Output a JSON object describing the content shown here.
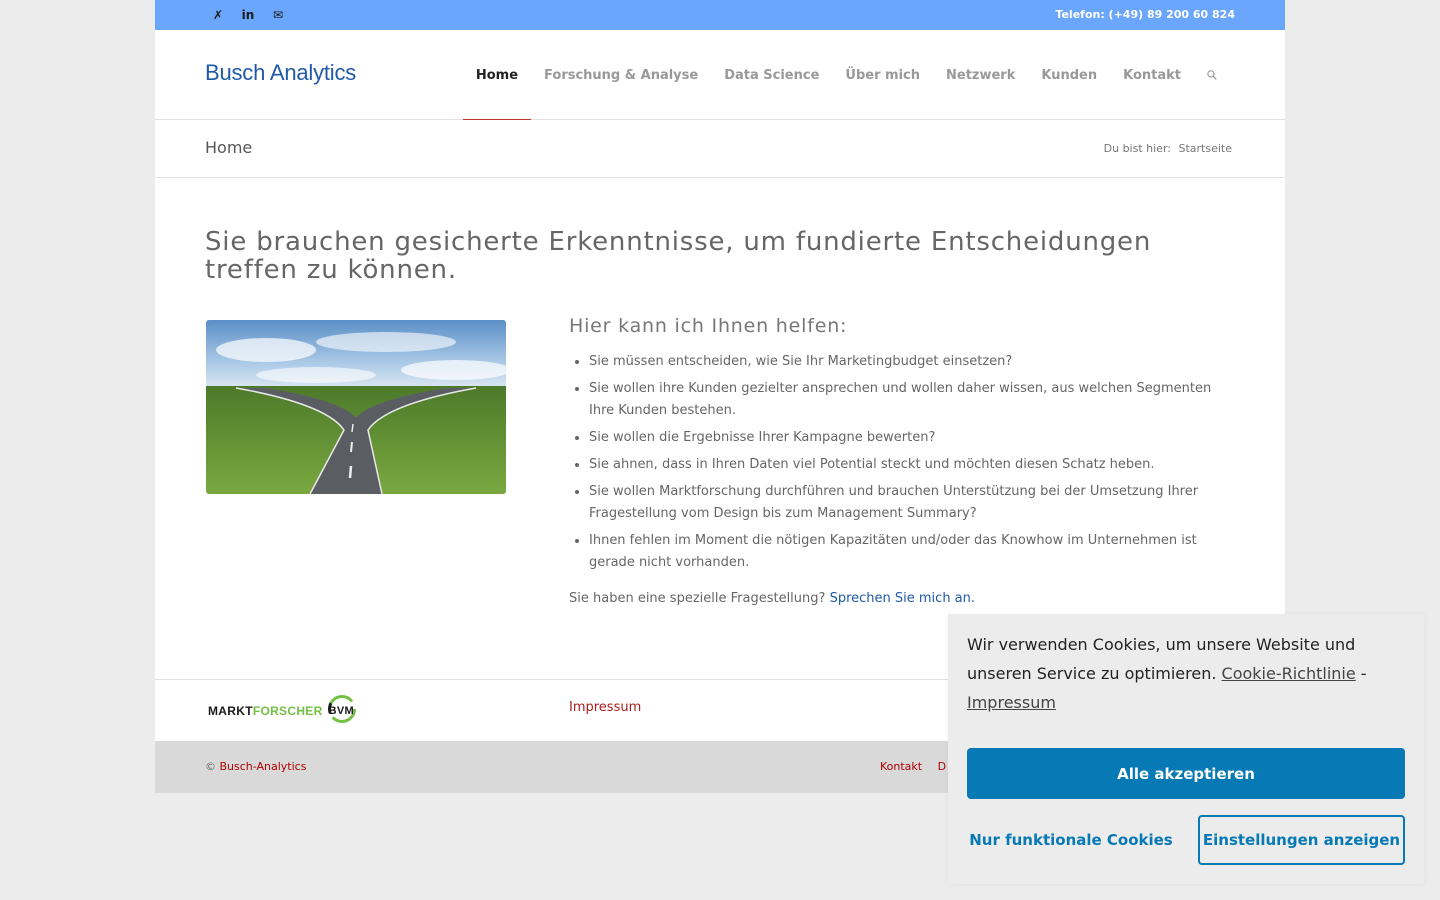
{
  "topbar": {
    "social": [
      "xing-icon",
      "linkedin-icon",
      "mail-icon"
    ],
    "xing_glyph": "✗",
    "linkedin_glyph": "in",
    "mail_glyph": "✉",
    "phone": "Telefon: (+49) 89 200 60 824"
  },
  "header": {
    "logo": "Busch Analytics",
    "nav": [
      "Home",
      "Forschung & Analyse",
      "Data Science",
      "Über mich",
      "Netzwerk",
      "Kunden",
      "Kontakt"
    ],
    "active_nav": "Home"
  },
  "titlebar": {
    "title": "Home",
    "crumb_prefix": "Du bist hier:",
    "crumb": "Startseite"
  },
  "main": {
    "heading": "Sie brauchen gesicherte Erkenntnisse, um fundierte Entscheidungen treffen zu können.",
    "subheading": "Hier kann ich Ihnen helfen:",
    "bullets": [
      "Sie müssen entscheiden, wie Sie Ihr Marketingbudget einsetzen?",
      "Sie wollen ihre Kunden gezielter ansprechen und wollen daher wissen, aus welchen Segmenten Ihre Kunden bestehen.",
      "Sie wollen die Ergebnisse Ihrer Kampagne bewerten?",
      "Sie ahnen, dass in Ihren Daten viel Potential steckt und möchten diesen Schatz heben.",
      "Sie wollen Marktforschung durchführen und brauchen Unterstützung bei der Umsetzung Ihrer Fragestellung vom Design bis zum Management Summary?",
      "Ihnen fehlen im Moment die nötigen Kapazitäten und/oder das Knowhow im Unternehmen ist gerade nicht vorhanden."
    ],
    "cta_text": "Sie haben eine spezielle Fragestellung?",
    "cta_link": "Sprechen Sie mich an."
  },
  "footer": {
    "logo_part1": "MARKT",
    "logo_part2": "FORSCHER",
    "logo_part3": "BVM",
    "impressum": "Impressum"
  },
  "socket": {
    "copy_symbol": "©",
    "copy_link": "Busch-Analytics",
    "links": [
      "Kontakt",
      "D"
    ]
  },
  "cookie": {
    "message": "Wir verwenden Cookies, um unsere Website und unseren Service zu optimieren.",
    "policy_link": "Cookie-Richtlinie",
    "separator": "-",
    "impressum_link": "Impressum",
    "accept": "Alle akzeptieren",
    "functional": "Nur funktionale Cookies",
    "settings": "Einstellungen anzeigen"
  },
  "colors": {
    "topbar": "#6aa6fc",
    "brand": "#1e5aa8",
    "accent_red": "#c0392b",
    "cookie_button": "#0779b5"
  }
}
